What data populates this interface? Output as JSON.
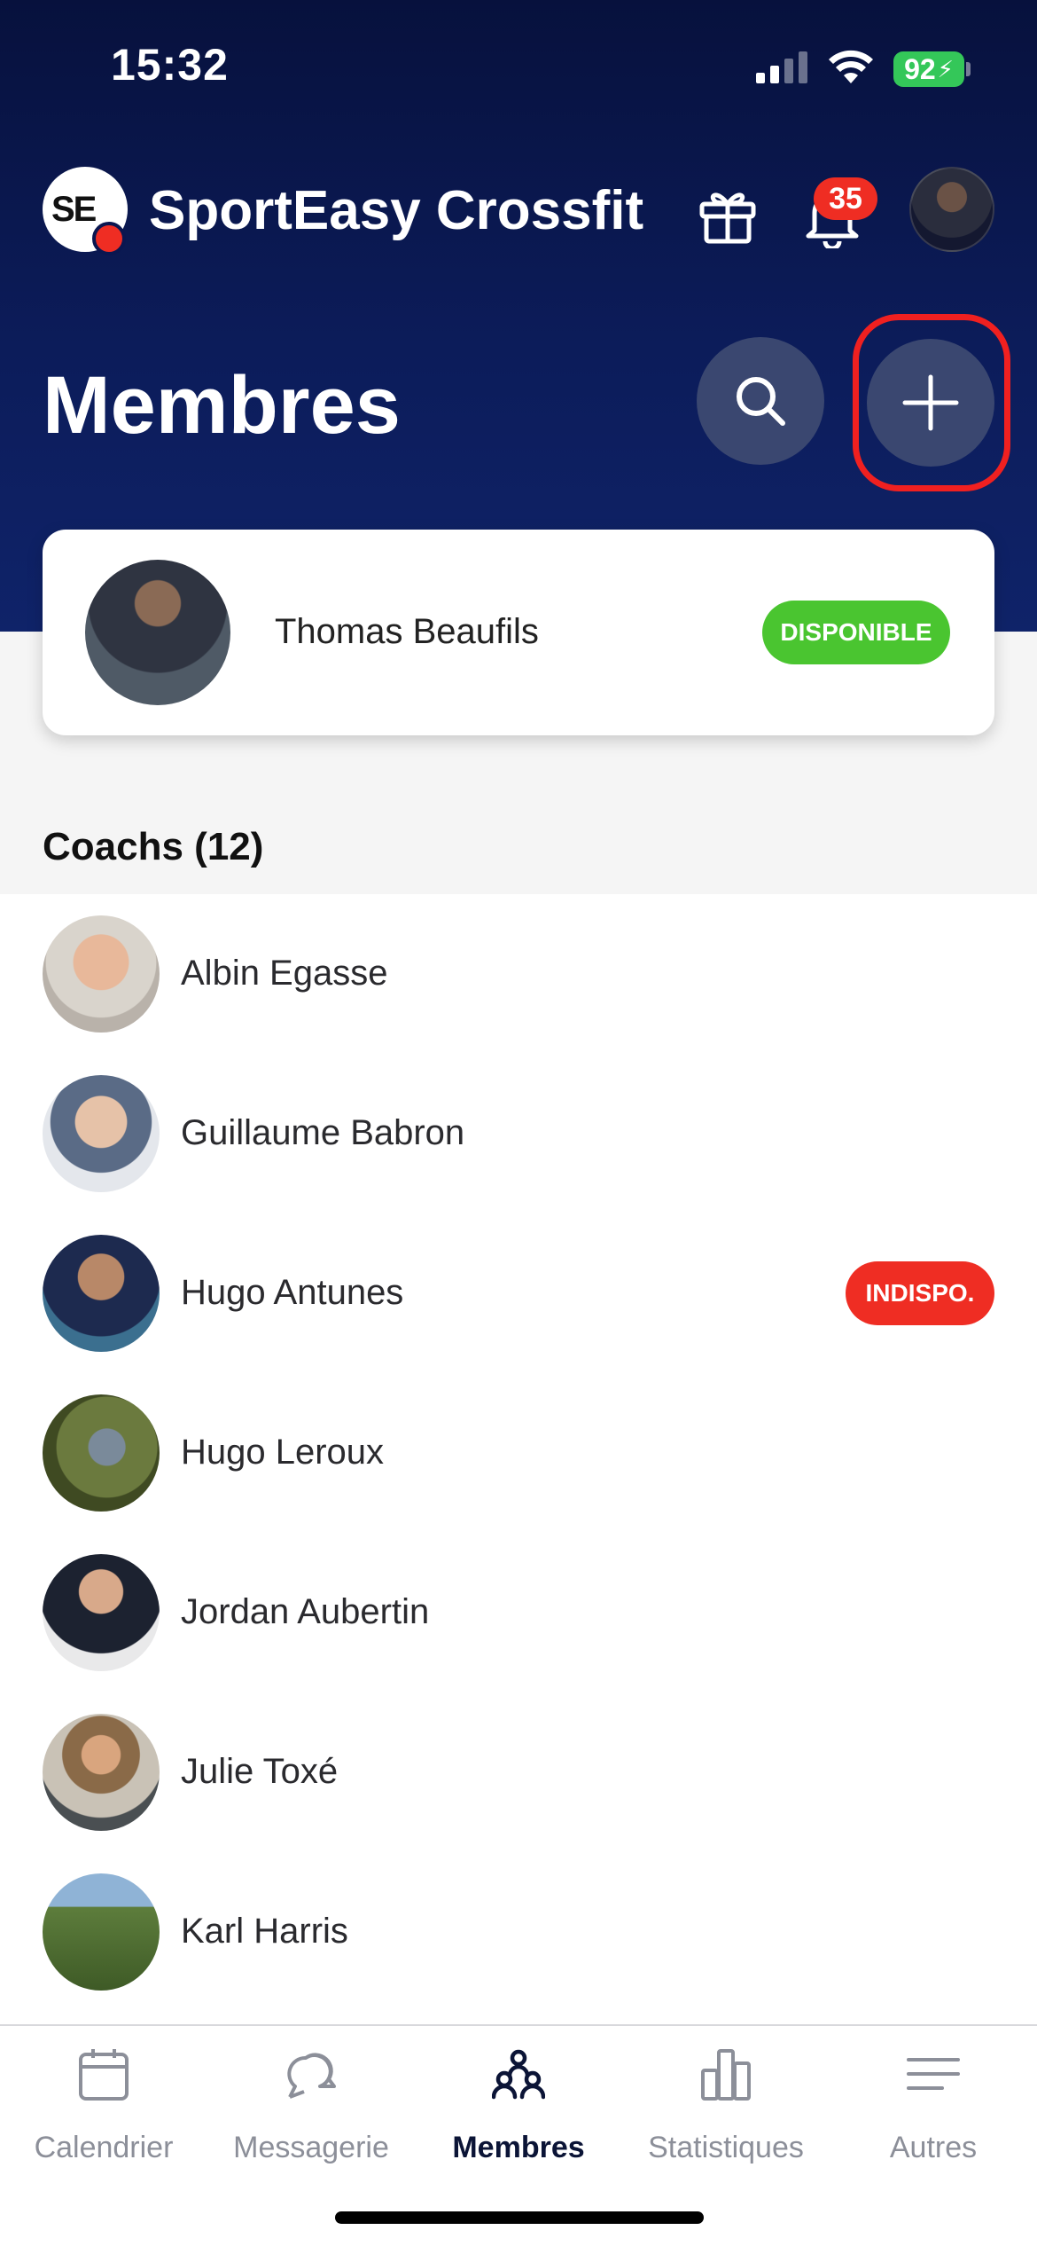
{
  "status_bar": {
    "time": "15:32",
    "battery": "92"
  },
  "header": {
    "logo_text": "SE",
    "club_name": "SportEasy Crossfit",
    "notification_count": "35",
    "icons": [
      "gift-icon",
      "bell-icon",
      "user-avatar"
    ]
  },
  "page": {
    "title": "Membres",
    "search_icon": "search-icon",
    "add_icon": "plus-icon"
  },
  "me": {
    "name": "Thomas Beaufils",
    "status": "DISPONIBLE",
    "status_color": "#4ac530"
  },
  "section": {
    "title": "Coachs (12)"
  },
  "members": [
    {
      "name": "Albin Egasse",
      "badge": ""
    },
    {
      "name": "Guillaume Babron",
      "badge": ""
    },
    {
      "name": "Hugo Antunes",
      "badge": "INDISPO."
    },
    {
      "name": "Hugo Leroux",
      "badge": ""
    },
    {
      "name": "Jordan Aubertin",
      "badge": ""
    },
    {
      "name": "Julie Toxé",
      "badge": ""
    },
    {
      "name": "Karl Harris",
      "badge": ""
    }
  ],
  "tabs": [
    {
      "label": "Calendrier",
      "icon": "calendar-icon"
    },
    {
      "label": "Messagerie",
      "icon": "chat-icon"
    },
    {
      "label": "Membres",
      "icon": "members-icon",
      "active": true
    },
    {
      "label": "Statistiques",
      "icon": "stats-icon"
    },
    {
      "label": "Autres",
      "icon": "menu-icon"
    }
  ],
  "colors": {
    "header_bg": "#0c1c5a",
    "unavailable": "#ef2d23",
    "available": "#4ac530",
    "highlight": "#f02020"
  }
}
